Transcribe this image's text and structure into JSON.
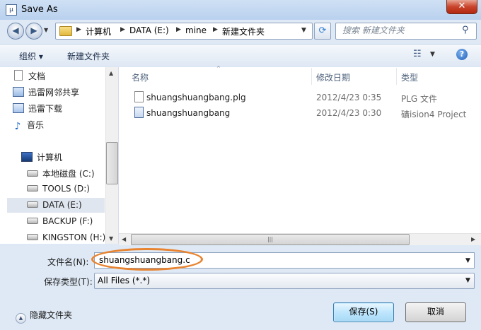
{
  "window": {
    "title": "Save As",
    "close_label": "✕"
  },
  "address": {
    "crumbs": [
      "计算机",
      "DATA (E:)",
      "mine",
      "新建文件夹"
    ],
    "search_placeholder": "搜索 新建文件夹"
  },
  "toolbar": {
    "organize_label": "组织 ▾",
    "new_folder_label": "新建文件夹",
    "help_label": "?"
  },
  "nav": {
    "items": [
      {
        "label": "文档",
        "icon": "document-icon"
      },
      {
        "label": "迅雷网邻共享",
        "icon": "share-folder-icon"
      },
      {
        "label": "迅雷下载",
        "icon": "download-folder-icon"
      },
      {
        "label": "音乐",
        "icon": "music-icon"
      },
      {
        "label": "计算机",
        "icon": "computer-icon"
      },
      {
        "label": "本地磁盘 (C:)",
        "icon": "system-drive-icon"
      },
      {
        "label": "TOOLS (D:)",
        "icon": "drive-icon"
      },
      {
        "label": "DATA (E:)",
        "icon": "drive-icon",
        "selected": true
      },
      {
        "label": "BACKUP (F:)",
        "icon": "drive-icon"
      },
      {
        "label": "KINGSTON (H:)",
        "icon": "usb-drive-icon"
      }
    ]
  },
  "files": {
    "columns": [
      "名称",
      "修改日期",
      "类型"
    ],
    "rows": [
      {
        "name": "shuangshuangbang.plg",
        "date": "2012/4/23 0:35",
        "type": "PLG 文件"
      },
      {
        "name": "shuangshuangbang",
        "date": "2012/4/23 0:30",
        "type": "礦ision4 Project"
      }
    ]
  },
  "save": {
    "filename_label": "文件名(N):",
    "filename_value": "shuangshuangbang.c",
    "filetype_label": "保存类型(T):",
    "filetype_value": "All Files (*.*)",
    "hide_folders_label": "隐藏文件夹",
    "save_button": "保存(S)",
    "cancel_button": "取消"
  },
  "colors": {
    "annotation_oval": "#e8832f",
    "window_bg": "#dfe9f5"
  }
}
